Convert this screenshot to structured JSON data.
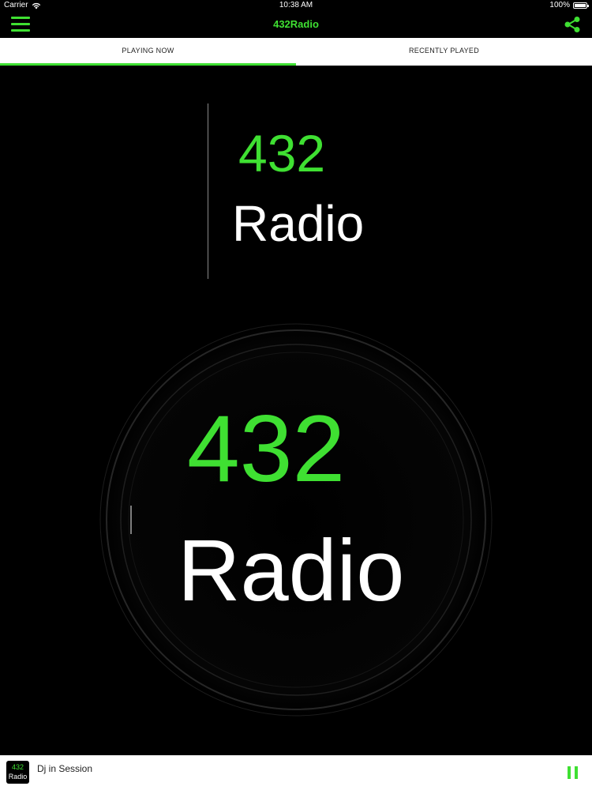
{
  "status_bar": {
    "carrier": "Carrier",
    "time": "10:38 AM",
    "battery": "100%",
    "battery_level": 1.0
  },
  "nav": {
    "title": "432Radio",
    "menu_icon": "hamburger-menu-icon",
    "share_icon": "share-icon"
  },
  "tabs": [
    {
      "label": "PLAYING NOW",
      "active": true
    },
    {
      "label": "RECENTLY PLAYED",
      "active": false
    }
  ],
  "logo": {
    "number": "432",
    "word": "Radio"
  },
  "player": {
    "thumb_number": "432",
    "thumb_word": "Radio",
    "track": "Dj in Session",
    "control_icon": "pause-icon"
  },
  "colors": {
    "accent": "#3fe032",
    "background": "#000000",
    "bar": "#ffffff"
  }
}
